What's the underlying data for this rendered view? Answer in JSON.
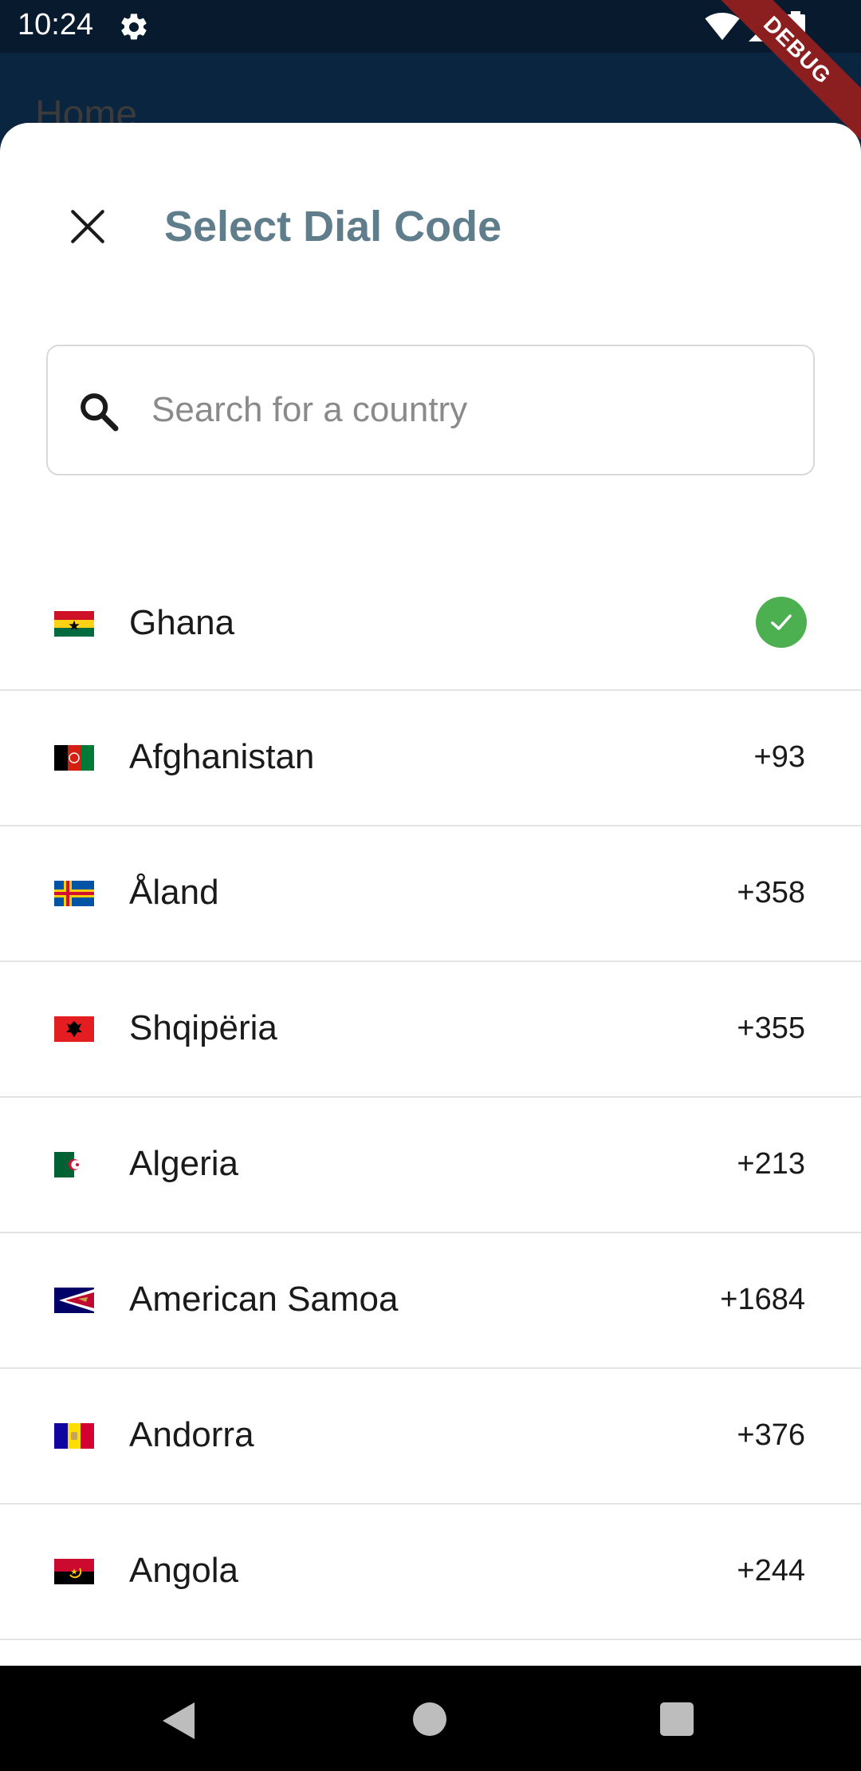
{
  "status_bar": {
    "time": "10:24",
    "icons": [
      "gear-icon",
      "wifi-icon",
      "signal-icon",
      "battery-icon"
    ]
  },
  "debug_banner": "DEBUG",
  "app_bar": {
    "title": "Home"
  },
  "sheet": {
    "title": "Select Dial Code",
    "close_icon": "close-icon",
    "search": {
      "placeholder": "Search for a country",
      "value": ""
    }
  },
  "selected_country": {
    "name": "Ghana",
    "flag": "ghana-flag",
    "selected": true
  },
  "countries": [
    {
      "name": "Afghanistan",
      "dial_code": "+93",
      "flag": "afghanistan-flag"
    },
    {
      "name": "Åland",
      "dial_code": "+358",
      "flag": "aland-flag"
    },
    {
      "name": "Shqipëria",
      "dial_code": "+355",
      "flag": "albania-flag"
    },
    {
      "name": "Algeria",
      "dial_code": "+213",
      "flag": "algeria-flag"
    },
    {
      "name": "American Samoa",
      "dial_code": "+1684",
      "flag": "american-samoa-flag"
    },
    {
      "name": "Andorra",
      "dial_code": "+376",
      "flag": "andorra-flag"
    },
    {
      "name": "Angola",
      "dial_code": "+244",
      "flag": "angola-flag"
    }
  ],
  "colors": {
    "title": "#607d8b",
    "check": "#4caf50",
    "app_bar": "#0a2540",
    "debug_banner": "#8b1f1f"
  },
  "nav_bar": {
    "icons": [
      "back-icon",
      "home-icon",
      "recents-icon"
    ]
  }
}
